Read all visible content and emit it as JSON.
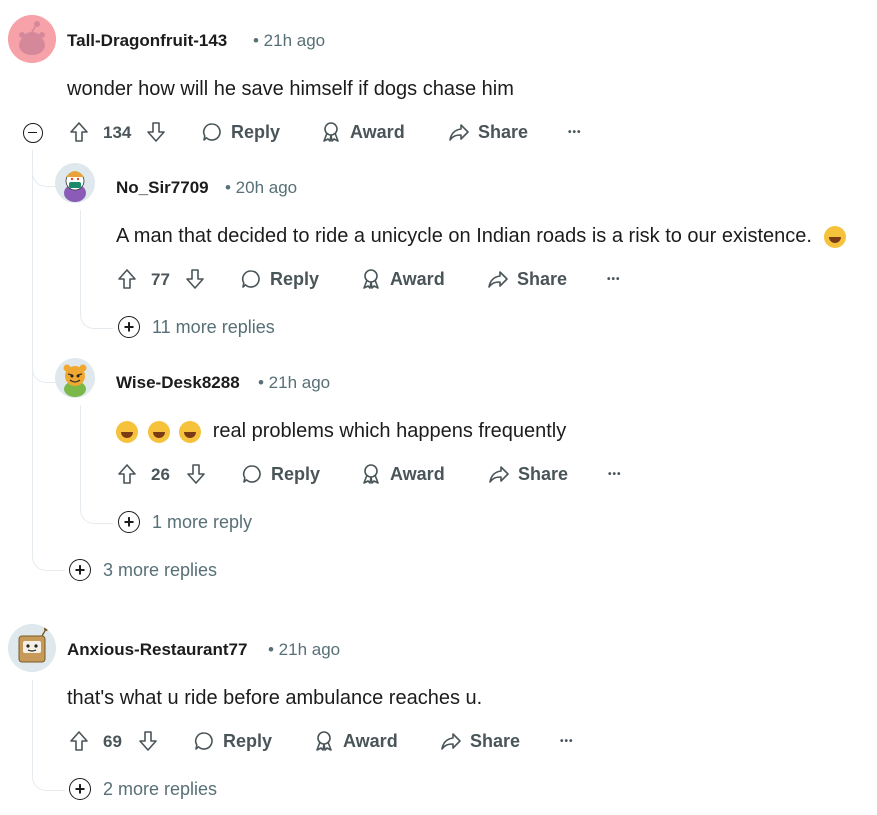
{
  "comments": [
    {
      "username": "Tall-Dragonfruit-143",
      "time": "• 21h ago",
      "text": "wonder how will he save himself if dogs chase him",
      "votes": "134",
      "reply": "Reply",
      "award": "Award",
      "share": "Share",
      "more": "•••",
      "more_replies": "3 more replies",
      "avatar_color": "#f7a1a8"
    },
    {
      "username": "No_Sir7709",
      "time": "• 20h ago",
      "text": "A man that decided to ride a unicycle on Indian roads is a risk to our existence.",
      "votes": "77",
      "reply": "Reply",
      "award": "Award",
      "share": "Share",
      "more": "•••",
      "more_replies": "11 more replies"
    },
    {
      "username": "Wise-Desk8288",
      "time": "• 21h ago",
      "text": "real problems which happens frequently",
      "votes": "26",
      "reply": "Reply",
      "award": "Award",
      "share": "Share",
      "more": "•••",
      "more_replies": "1 more reply"
    },
    {
      "username": "Anxious-Restaurant77",
      "time": "• 21h ago",
      "text": "that's what u ride before ambulance reaches u.",
      "votes": "69",
      "reply": "Reply",
      "award": "Award",
      "share": "Share",
      "more": "•••",
      "more_replies": "2 more replies"
    }
  ],
  "colors": {
    "thread_line": "#e5ebee",
    "text": "#1c1c1c",
    "meta": "#576f76",
    "action": "#4a5559"
  }
}
